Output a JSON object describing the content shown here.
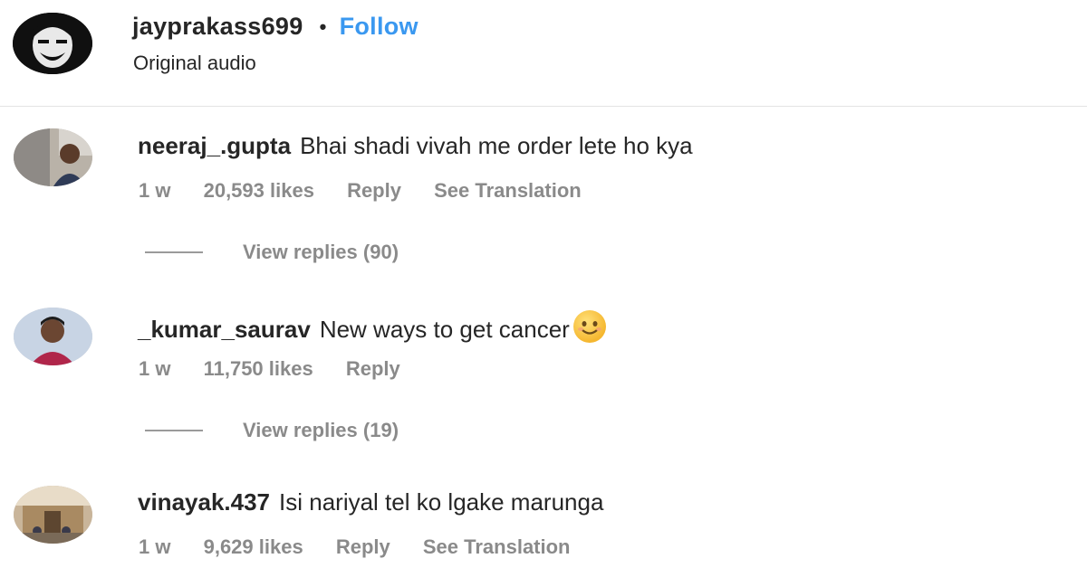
{
  "header": {
    "username": "jayprakass699",
    "separator": "•",
    "follow_label": "Follow",
    "subtitle": "Original audio"
  },
  "comments": [
    {
      "username": "neeraj_.gupta",
      "text": "Bhai shadi vivah me order lete ho kya",
      "age": "1 w",
      "likes": "20,593 likes",
      "reply_label": "Reply",
      "translate_label": "See Translation",
      "view_replies": "View replies (90)"
    },
    {
      "username": "_kumar_saurav",
      "text": "New ways to get cancer",
      "emoji": "smiling-face-emoji",
      "age": "1 w",
      "likes": "11,750 likes",
      "reply_label": "Reply",
      "view_replies": "View replies (19)"
    },
    {
      "username": "vinayak.437",
      "text": "Isi nariyal tel ko lgake marunga",
      "age": "1 w",
      "likes": "9,629 likes",
      "reply_label": "Reply",
      "translate_label": "See Translation"
    }
  ],
  "colors": {
    "link_blue": "#3a98f0",
    "meta_gray": "#8a8a8a",
    "text": "#262626"
  }
}
